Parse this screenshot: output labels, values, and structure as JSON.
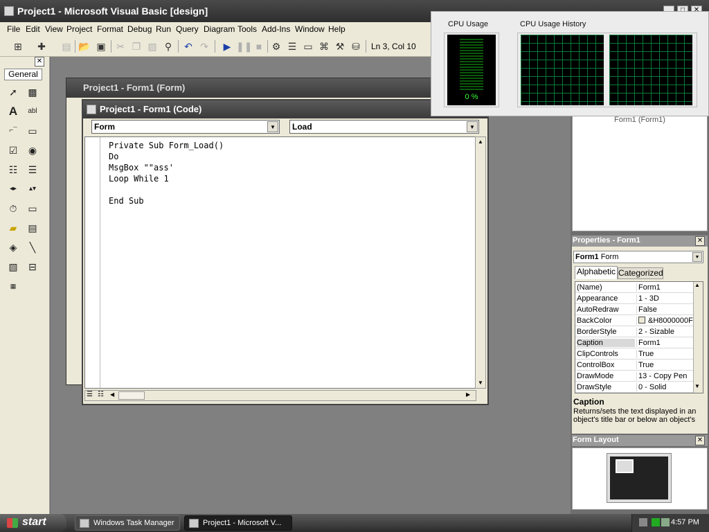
{
  "window": {
    "title": "Project1 - Microsoft Visual Basic [design]",
    "min": "_",
    "max": "□",
    "close": "✕"
  },
  "menu": [
    "File",
    "Edit",
    "View",
    "Project",
    "Format",
    "Debug",
    "Run",
    "Query",
    "Diagram",
    "Tools",
    "Add-Ins",
    "Window",
    "Help"
  ],
  "toolbar": {
    "position": "Ln 3, Col 10"
  },
  "toolbox": {
    "tab": "General",
    "close": "✕"
  },
  "form_window": {
    "title": "Project1 - Form1 (Form)"
  },
  "code_window": {
    "title": "Project1 - Form1 (Code)",
    "object_combo": "Form",
    "proc_combo": "Load",
    "code": "Private Sub Form_Load()\nDo\nMsgBox \"\"ass'\nLoop While 1\n\nEnd Sub"
  },
  "project_explorer": {
    "item": "Form1 (Form1)"
  },
  "properties": {
    "title": "Properties - Form1",
    "object": "Form1",
    "object_type": "Form",
    "tab_alpha": "Alphabetic",
    "tab_cat": "Categorized",
    "rows": [
      {
        "name": "(Name)",
        "value": "Form1"
      },
      {
        "name": "Appearance",
        "value": "1 - 3D"
      },
      {
        "name": "AutoRedraw",
        "value": "False"
      },
      {
        "name": "BackColor",
        "value": "&H8000000F"
      },
      {
        "name": "BorderStyle",
        "value": "2 - Sizable"
      },
      {
        "name": "Caption",
        "value": "Form1"
      },
      {
        "name": "ClipControls",
        "value": "True"
      },
      {
        "name": "ControlBox",
        "value": "True"
      },
      {
        "name": "DrawMode",
        "value": "13 - Copy Pen"
      },
      {
        "name": "DrawStyle",
        "value": "0 - Solid"
      }
    ],
    "selected_row": "Caption",
    "desc_title": "Caption",
    "desc_text": "Returns/sets the text displayed in an object's title bar or below an object's"
  },
  "form_layout": {
    "title": "Form Layout"
  },
  "task_manager": {
    "cpu_usage_label": "CPU Usage",
    "cpu_history_label": "CPU Usage History",
    "cpu_percent": "0 %"
  },
  "taskbar": {
    "start": "start",
    "tasks": [
      "Windows Task Manager",
      "Project1 - Microsoft V..."
    ],
    "clock": "4:57 PM"
  }
}
